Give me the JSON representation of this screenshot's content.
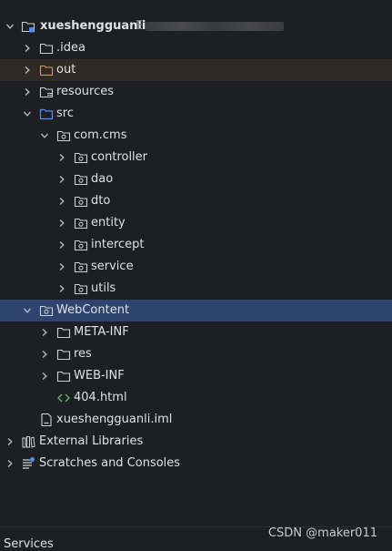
{
  "project": {
    "name": "xueshengguanli",
    "path_hint": "E"
  },
  "items": {
    "idea": ".idea",
    "out": "out",
    "resources": "resources",
    "src": "src",
    "com_cms": "com.cms",
    "controller": "controller",
    "dao": "dao",
    "dto": "dto",
    "entity": "entity",
    "intercept": "intercept",
    "service": "service",
    "utils": "utils",
    "webcontent": "WebContent",
    "meta_inf": "META-INF",
    "res": "res",
    "web_inf": "WEB-INF",
    "html404": "404.html",
    "iml": "xueshengguanli.iml",
    "external_libraries": "External Libraries",
    "scratches": "Scratches and Consoles"
  },
  "bottom_panel": {
    "services_label": "Services"
  },
  "watermark": "CSDN @maker011",
  "colors": {
    "background": "#1e1f22",
    "selection": "#2e436e",
    "out_folder_bg": "#2f2a24",
    "folder_stroke": "#ced0d6",
    "source_folder": "#4e8ff5",
    "excluded_folder": "#d19a66",
    "html_icon": "#5fb865"
  }
}
